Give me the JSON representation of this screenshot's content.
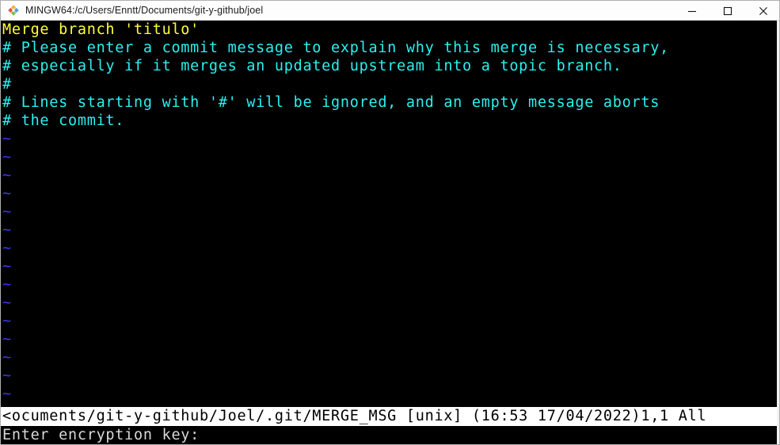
{
  "window": {
    "title": "MINGW64:/c/Users/Enntt/Documents/git-y-github/joel",
    "app_icon": "git-bash-diamond-icon",
    "controls": {
      "minimize": "minimize-icon",
      "maximize": "maximize-icon",
      "close": "close-icon"
    },
    "background_color": "#000000",
    "titlebar_color": "#fdfdfd"
  },
  "terminal": {
    "colors": {
      "subject": "#ffff3a",
      "comment": "#2bf0f0",
      "tilde": "#3a3aee",
      "statusline_bg": "#ffffff",
      "statusline_fg": "#000000",
      "cmdline_fg": "#d8d8d8"
    },
    "buffer_lines": [
      {
        "kind": "subject",
        "text": "Merge branch 'titulo'"
      },
      {
        "kind": "comment",
        "text": "# Please enter a commit message to explain why this merge is necessary,"
      },
      {
        "kind": "comment",
        "text": "# especially if it merges an updated upstream into a topic branch."
      },
      {
        "kind": "comment",
        "text": "#"
      },
      {
        "kind": "comment",
        "text": "# Lines starting with '#' will be ignored, and an empty message aborts"
      },
      {
        "kind": "comment",
        "text": "# the commit."
      },
      {
        "kind": "tilde",
        "text": "~"
      },
      {
        "kind": "tilde",
        "text": "~"
      },
      {
        "kind": "tilde",
        "text": "~"
      },
      {
        "kind": "tilde",
        "text": "~"
      },
      {
        "kind": "tilde",
        "text": "~"
      },
      {
        "kind": "tilde",
        "text": "~"
      },
      {
        "kind": "tilde",
        "text": "~"
      },
      {
        "kind": "tilde",
        "text": "~"
      },
      {
        "kind": "tilde",
        "text": "~"
      },
      {
        "kind": "tilde",
        "text": "~"
      },
      {
        "kind": "tilde",
        "text": "~"
      },
      {
        "kind": "tilde",
        "text": "~"
      },
      {
        "kind": "tilde",
        "text": "~"
      },
      {
        "kind": "tilde",
        "text": "~"
      },
      {
        "kind": "tilde",
        "text": "~"
      }
    ],
    "statusline": {
      "text": "<ocuments/git-y-github/Joel/.git/MERGE_MSG [unix] (16:53 17/04/2022)1,1 All",
      "file_path": "<ocuments/git-y-github/Joel/.git/MERGE_MSG",
      "fileformat": "[unix]",
      "timestamp": "(16:53 17/04/2022)",
      "cursor_position": "1,1",
      "scroll_position": "All"
    },
    "cmdline": {
      "prompt": "Enter encryption key:"
    }
  }
}
